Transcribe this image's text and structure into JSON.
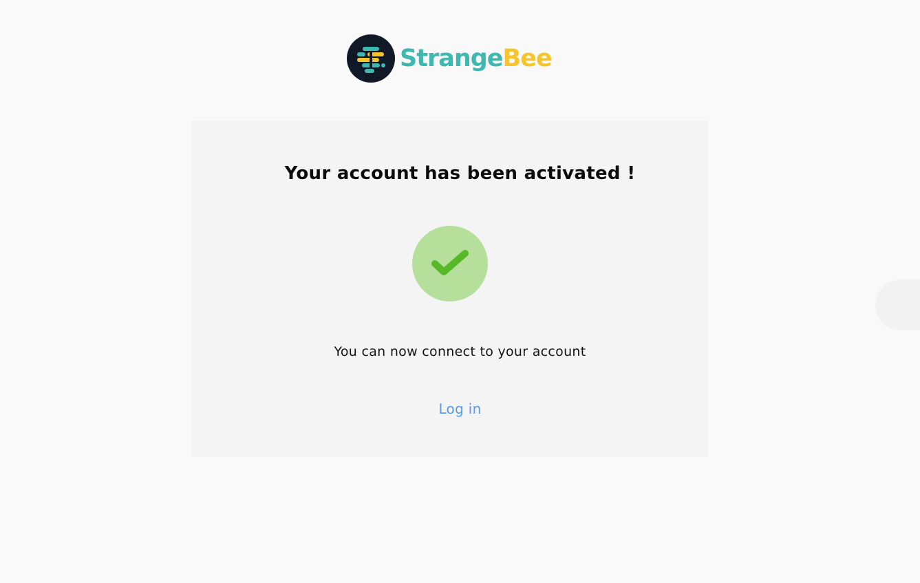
{
  "brand": {
    "logo_icon": "strangebee-logo-icon",
    "name_part1": "Strange",
    "name_part2": "Bee",
    "colors": {
      "mark_background": "#111827",
      "teal": "#3fb8b0",
      "yellow": "#f6c52b"
    }
  },
  "activation": {
    "title": "Your account has been activated !",
    "status_icon": "check-circle-icon",
    "message": "You can now connect to your account",
    "login_link": "Log in",
    "colors": {
      "success_circle": "#b7df9c",
      "success_check": "#57b82a",
      "link": "#5b9ae8"
    }
  }
}
